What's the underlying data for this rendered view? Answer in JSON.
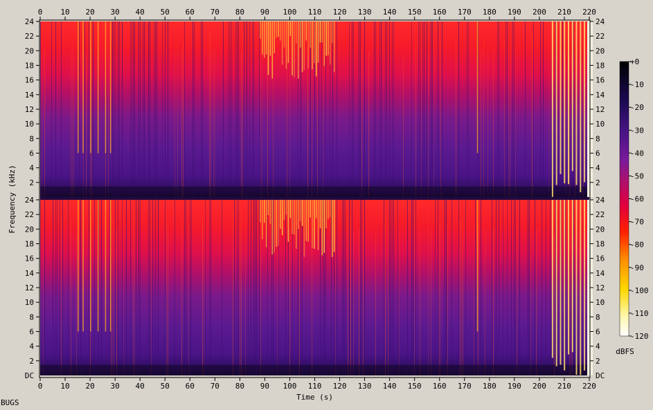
{
  "chart_data": {
    "type": "heatmap",
    "subtype": "stereo spectrogram (two channels)",
    "xlabel": "Time (s)",
    "ylabel": "Frequency (kHz)",
    "xlim": [
      0,
      220
    ],
    "x_ticks": [
      0,
      10,
      20,
      30,
      40,
      50,
      60,
      70,
      80,
      90,
      100,
      110,
      120,
      130,
      140,
      150,
      160,
      170,
      180,
      190,
      200,
      210,
      220
    ],
    "ylim_khz": [
      0,
      24
    ],
    "y_ticks": [
      2,
      4,
      6,
      8,
      10,
      12,
      14,
      16,
      18,
      20,
      22,
      24
    ],
    "y_zero_label": "DC",
    "channels": 2,
    "audio_end_seconds": 220,
    "colorbar": {
      "unit": "dBFS",
      "range": [
        -120,
        0
      ],
      "ticks": [
        "+0",
        "-10",
        "-20",
        "-30",
        "-40",
        "-50",
        "-60",
        "-70",
        "-80",
        "-90",
        "-100",
        "-110",
        "-120"
      ],
      "colormap": [
        "#ffffff",
        "#fff58c",
        "#ffc800",
        "#ff7a00",
        "#ff1a1a",
        "#e0003a",
        "#b0106a",
        "#7a1a9a",
        "#4a1486",
        "#1a0a50",
        "#000000"
      ]
    },
    "features": [
      {
        "description": "broadband transient streaks reaching 24 kHz",
        "time_range_s": [
          88,
          118
        ]
      },
      {
        "description": "strong repeated vertical transients",
        "time_range_s": [
          205,
          220
        ]
      },
      {
        "description": "isolated bright transient lines",
        "times_s": [
          15,
          17,
          20,
          23,
          26,
          28,
          175
        ]
      }
    ]
  },
  "footer": {
    "text": "BUGS"
  },
  "colors": {
    "background": "#d8d4cc",
    "plot_bg": "#1a0830"
  }
}
